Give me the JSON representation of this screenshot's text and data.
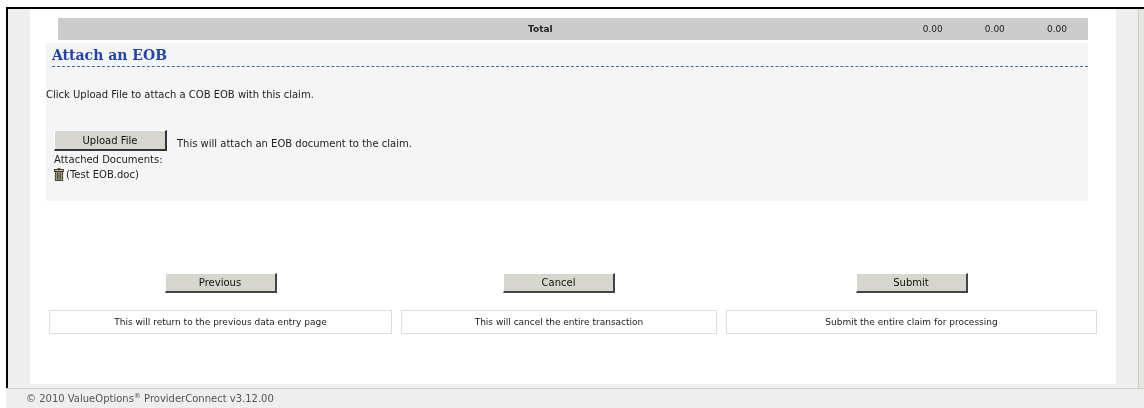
{
  "totals_row": {
    "label": "Total",
    "values": [
      "0.00",
      "0.00",
      "0.00"
    ]
  },
  "attach_section": {
    "title": "Attach an EOB",
    "instructions": "Click Upload File to attach a COB EOB with this claim.",
    "upload_button": "Upload File",
    "upload_hint": "This will attach an EOB document to the claim.",
    "attached_label": "Attached Documents:",
    "documents": [
      "(Test EOB.doc)"
    ]
  },
  "actions": [
    {
      "button": "Previous",
      "description": "This will return to the previous data entry page"
    },
    {
      "button": "Cancel",
      "description": "This will cancel the entire transaction"
    },
    {
      "button": "Submit",
      "description": "Submit the entire claim for processing"
    }
  ],
  "footer": "© 2010 ValueOptions$^{®}$ ProviderConnect v3.12.00"
}
